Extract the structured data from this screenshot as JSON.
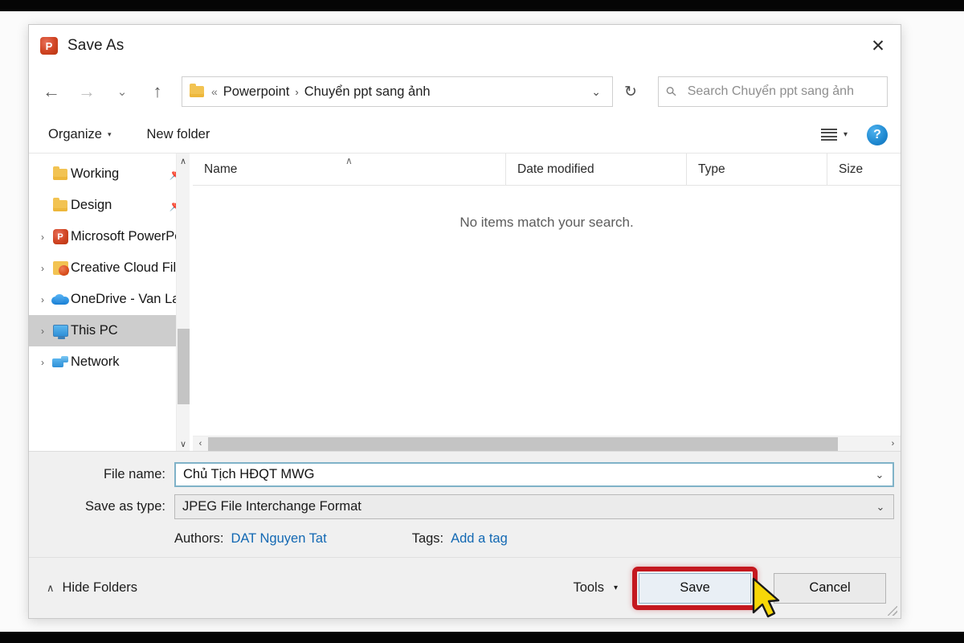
{
  "window": {
    "title": "Save As",
    "app_icon": "powerpoint-icon",
    "close_label": "✕"
  },
  "nav_toolbar": {
    "back": "←",
    "forward": "→",
    "recent": "⌄",
    "up": "↑",
    "breadcrumb": {
      "overflow": "«",
      "items": [
        "Powerpoint",
        "Chuyển ppt sang ảnh"
      ],
      "separator": "›",
      "dropdown": "⌄"
    },
    "refresh": "↻",
    "search": {
      "placeholder": "Search Chuyển ppt sang ảnh",
      "value": ""
    }
  },
  "command_bar": {
    "organize": "Organize",
    "organize_caret": "▾",
    "new_folder": "New folder",
    "view_caret": "▾",
    "help": "?"
  },
  "sidebar": {
    "items": [
      {
        "label": "Working",
        "icon": "folder-icon",
        "expander": "",
        "pinned": "📌",
        "selected": false
      },
      {
        "label": "Design",
        "icon": "folder-icon",
        "expander": "",
        "pinned": "📌",
        "selected": false
      },
      {
        "label": "Microsoft PowerPc",
        "icon": "powerpoint-icon",
        "expander": "›",
        "pinned": "",
        "selected": false
      },
      {
        "label": "Creative Cloud File",
        "icon": "creative-cloud-icon",
        "expander": "›",
        "pinned": "",
        "selected": false
      },
      {
        "label": "OneDrive - Van La",
        "icon": "onedrive-icon",
        "expander": "›",
        "pinned": "",
        "selected": false
      },
      {
        "label": "This PC",
        "icon": "this-pc-icon",
        "expander": "›",
        "pinned": "",
        "selected": true
      },
      {
        "label": "Network",
        "icon": "network-icon",
        "expander": "›",
        "pinned": "",
        "selected": false
      }
    ],
    "scroll_up": "∧",
    "scroll_down": "∨"
  },
  "file_list": {
    "columns": [
      "Name",
      "Date modified",
      "Type",
      "Size"
    ],
    "sort_indicator": "∧",
    "rows": [],
    "empty_message": "No items match your search.",
    "hscroll_left": "‹",
    "hscroll_right": "›"
  },
  "fields": {
    "file_name_label": "File name:",
    "file_name_value": "Chủ Tịch HĐQT MWG",
    "save_as_type_label": "Save as type:",
    "save_as_type_value": "JPEG File Interchange Format",
    "dropdown_caret": "⌄",
    "authors_label": "Authors:",
    "authors_value": "DAT Nguyen Tat",
    "tags_label": "Tags:",
    "tags_value": "Add a tag"
  },
  "footer": {
    "hide_folders_caret": "∧",
    "hide_folders": "Hide Folders",
    "tools": "Tools",
    "tools_caret": "▾",
    "save": "Save",
    "cancel": "Cancel"
  },
  "annotations": {
    "highlight_color": "#c4181f",
    "highlight_target": "Save",
    "cursor_color": "#f7d708"
  }
}
